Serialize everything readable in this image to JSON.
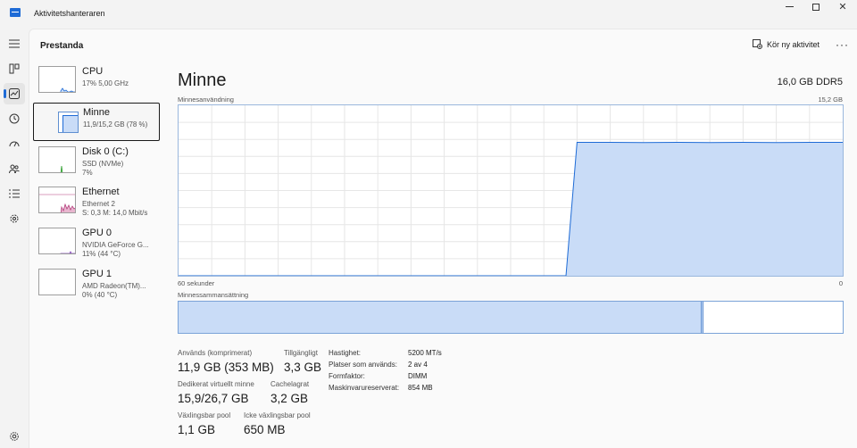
{
  "app": {
    "title": "Aktivitetshanteraren"
  },
  "header": {
    "title": "Prestanda",
    "run_task": "Kör ny aktivitet",
    "more": "···"
  },
  "rail": {
    "icons": [
      "menu-icon",
      "processes-icon",
      "performance-icon",
      "app-history-icon",
      "startup-apps-icon",
      "users-icon",
      "details-icon",
      "services-icon",
      "settings-icon"
    ],
    "active": "performance-icon"
  },
  "devices": [
    {
      "name": "CPU",
      "sub1": "17%  5,00 GHz",
      "sub2": "",
      "color": "#1e6bd6"
    },
    {
      "name": "Minne",
      "sub1": "11,9/15,2 GB (78 %)",
      "sub2": "",
      "color": "#1e6bd6"
    },
    {
      "name": "Disk 0 (C:)",
      "sub1": "SSD (NVMe)",
      "sub2": "7%",
      "color": "#2a9d2a"
    },
    {
      "name": "Ethernet",
      "sub1": "Ethernet 2",
      "sub2": "S: 0,3  M: 14,0 Mbit/s",
      "color": "#b33a7a"
    },
    {
      "name": "GPU 0",
      "sub1": "NVIDIA GeForce G...",
      "sub2": "11%  (44 °C)",
      "color": "#7a3ab3"
    },
    {
      "name": "GPU 1",
      "sub1": "AMD Radeon(TM)...",
      "sub2": "0%  (40 °C)",
      "color": "#7a3ab3"
    }
  ],
  "main": {
    "title": "Minne",
    "spec": "16,0 GB DDR5",
    "usage_label": "Minnesanvändning",
    "usage_max": "15,2 GB",
    "time_left": "60 sekunder",
    "time_right": "0",
    "composition_label": "Minnessammansättning",
    "composition": {
      "in_use_fraction": 0.787,
      "modified_fraction": 0.004
    }
  },
  "chart_data": {
    "type": "area",
    "x": [
      60,
      57,
      54,
      51,
      48,
      45,
      42,
      39,
      36,
      33,
      30,
      27,
      25,
      24,
      21,
      18,
      15,
      12,
      9,
      6,
      3,
      0
    ],
    "values": [
      0,
      0,
      0,
      0,
      0,
      0,
      0,
      0,
      0,
      0,
      0,
      0,
      0,
      11.9,
      11.9,
      11.88,
      11.9,
      11.88,
      11.9,
      11.88,
      11.9,
      11.9
    ],
    "ylim": [
      0,
      15.2
    ],
    "xlim": [
      60,
      0
    ],
    "title": "Minnesanvändning",
    "color": "#1e6bd6",
    "fill": "#c9dcf7",
    "grid": true
  },
  "stats": {
    "in_use_label": "Används (komprimerat)",
    "in_use": "11,9 GB (353 MB)",
    "available_label": "Tillgängligt",
    "available": "3,3 GB",
    "committed_label": "Dedikerat virtuellt minne",
    "committed": "15,9/26,7 GB",
    "cached_label": "Cachelagrat",
    "cached": "3,2 GB",
    "paged_label": "Växlingsbar pool",
    "paged": "1,1 GB",
    "nonpaged_label": "Icke växlingsbar pool",
    "nonpaged": "650 MB"
  },
  "details": [
    {
      "label": "Hastighet:",
      "value": "5200 MT/s"
    },
    {
      "label": "Platser som används:",
      "value": "2 av 4"
    },
    {
      "label": "Formfaktor:",
      "value": "DIMM"
    },
    {
      "label": "Maskinvarureserverat:",
      "value": "854 MB"
    }
  ]
}
